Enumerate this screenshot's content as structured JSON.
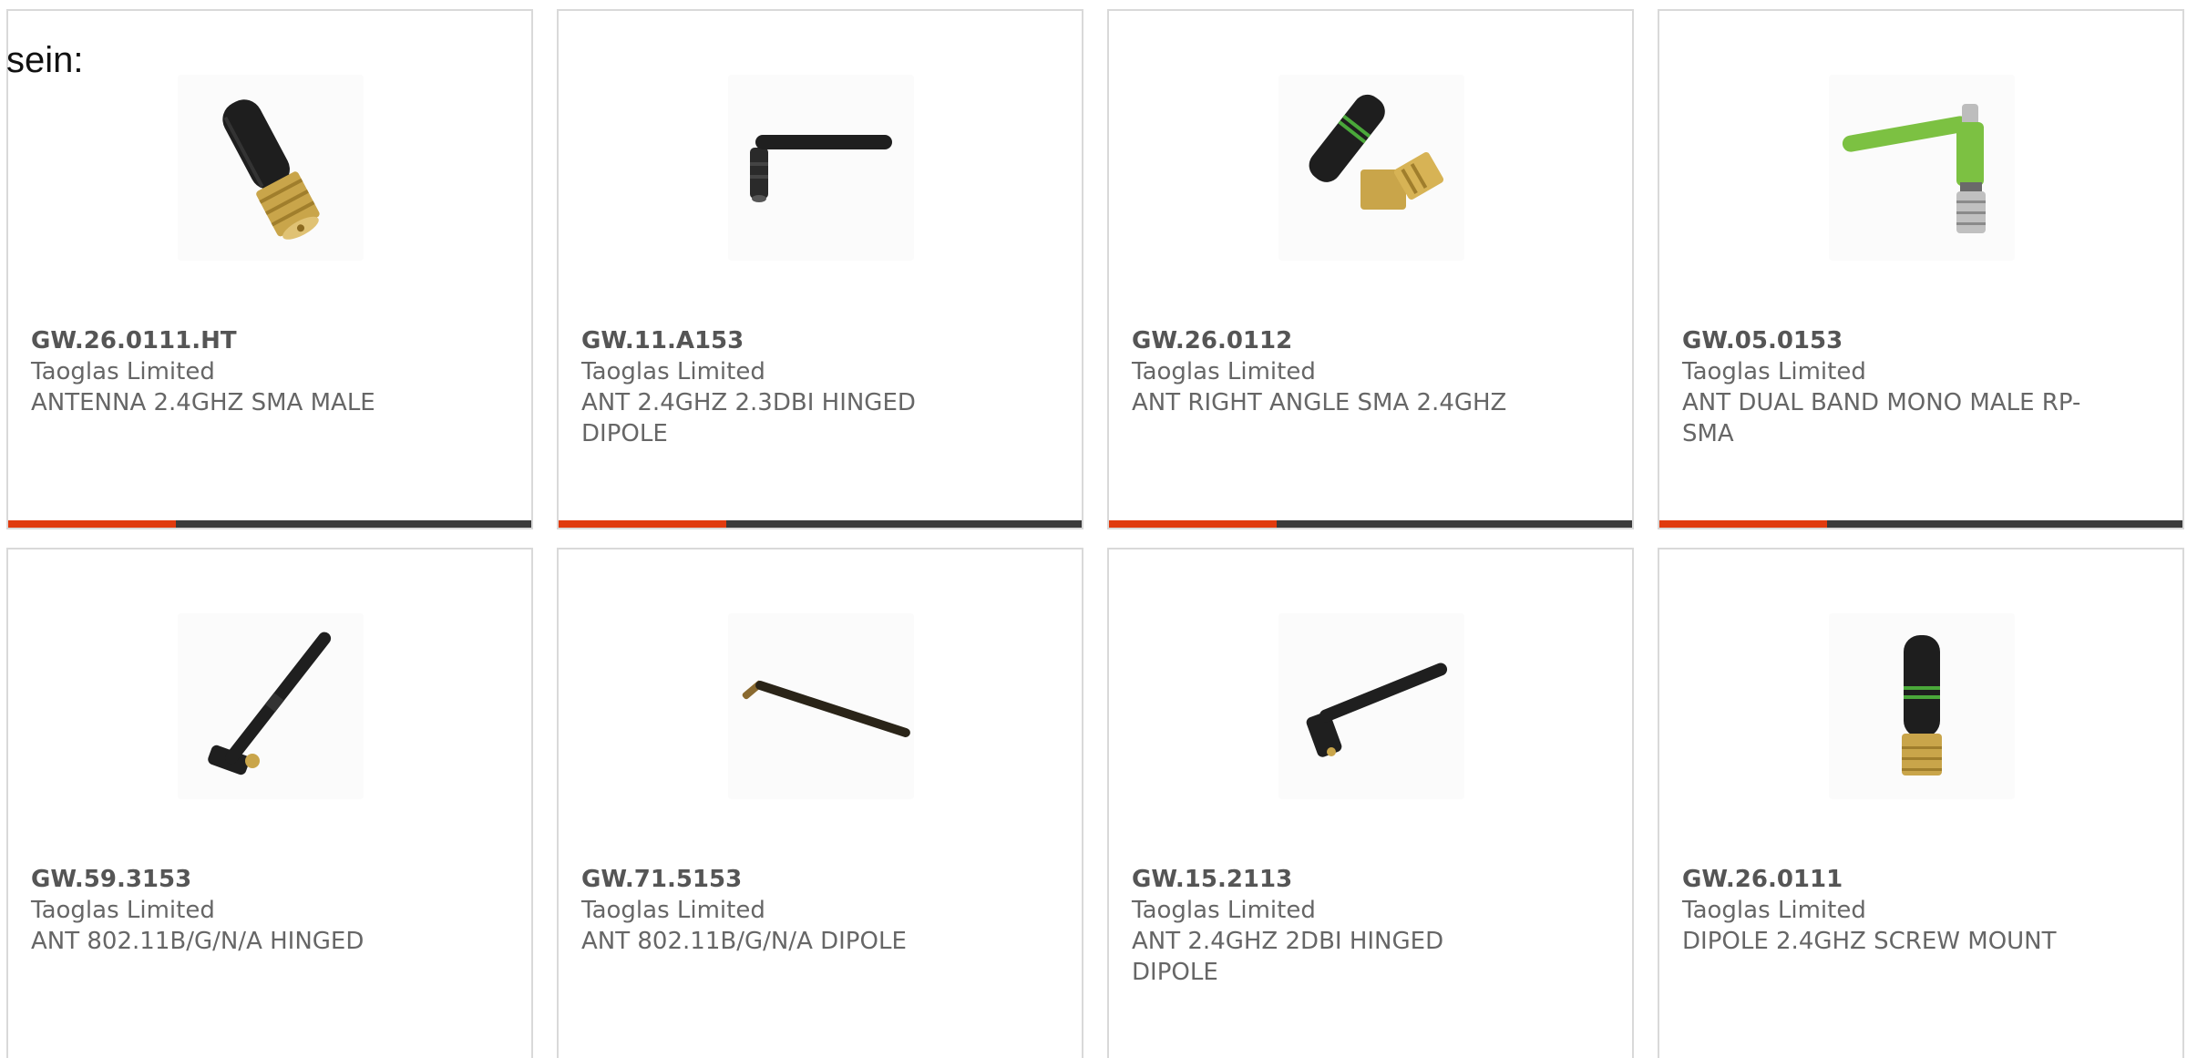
{
  "intro_text": "sein:",
  "colors": {
    "accent": "#e03a0e",
    "bar_track": "#3a3a3a",
    "card_border": "#d9d9d9",
    "text": "#666666"
  },
  "products": [
    {
      "part_number": "GW.26.0111.HT",
      "manufacturer": "Taoglas Limited",
      "description": "ANTENNA 2.4GHZ SMA MALE",
      "image_icon": "stubby-antenna-gold-sma-icon",
      "progress": 0.32
    },
    {
      "part_number": "GW.11.A153",
      "manufacturer": "Taoglas Limited",
      "description": "ANT 2.4GHZ 2.3DBI HINGED DIPOLE",
      "image_icon": "hinged-dipole-antenna-icon",
      "progress": 0.32
    },
    {
      "part_number": "GW.26.0112",
      "manufacturer": "Taoglas Limited",
      "description": "ANT RIGHT ANGLE SMA 2.4GHZ",
      "image_icon": "right-angle-antenna-icon",
      "progress": 0.32
    },
    {
      "part_number": "GW.05.0153",
      "manufacturer": "Taoglas Limited",
      "description": "ANT DUAL BAND MONO MALE RP-SMA",
      "image_icon": "green-hinged-antenna-icon",
      "progress": 0.32
    },
    {
      "part_number": "GW.59.3153",
      "manufacturer": "Taoglas Limited",
      "description": "ANT 802.11B/G/N/A HINGED",
      "image_icon": "angled-hinged-antenna-icon",
      "progress": null
    },
    {
      "part_number": "GW.71.5153",
      "manufacturer": "Taoglas Limited",
      "description": "ANT 802.11B/G/N/A DIPOLE",
      "image_icon": "long-dipole-antenna-icon",
      "progress": null
    },
    {
      "part_number": "GW.15.2113",
      "manufacturer": "Taoglas Limited",
      "description": "ANT 2.4GHZ 2DBI HINGED DIPOLE",
      "image_icon": "short-hinged-antenna-icon",
      "progress": null
    },
    {
      "part_number": "GW.26.0111",
      "manufacturer": "Taoglas Limited",
      "description": "DIPOLE 2.4GHZ SCREW MOUNT",
      "image_icon": "stubby-antenna-green-band-icon",
      "progress": null
    }
  ]
}
